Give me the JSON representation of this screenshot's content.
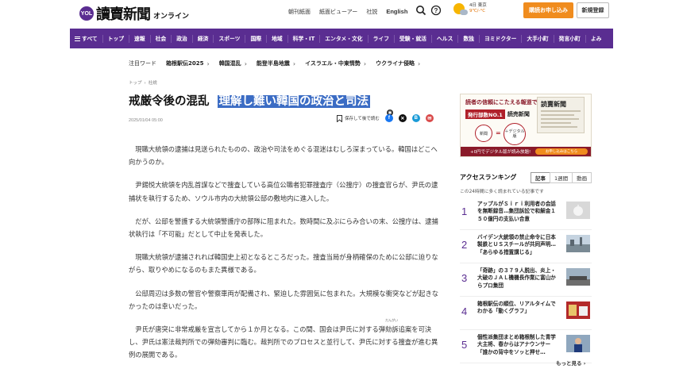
{
  "header": {
    "logo_badge": "YOL",
    "logo_text": "讀賣新聞",
    "logo_sub": "オンライン",
    "nav": [
      "朝刊紙面",
      "紙面ビューアー",
      "社説"
    ],
    "nav_english": "English",
    "weather": {
      "day": "4日 東京",
      "temp": "9℃/-°C"
    },
    "subscribe_label": "購読お申し込み",
    "register_label": "新規登録"
  },
  "mainnav": {
    "menu_label": "すべて",
    "items": [
      "トップ",
      "速報",
      "社会",
      "政治",
      "経済",
      "スポーツ",
      "国際",
      "地域",
      "科学・IT",
      "エンタメ・文化",
      "ライフ",
      "受験・就活",
      "ヘルス",
      "数独",
      "ヨミドクター",
      "大手小町",
      "発言小町",
      "よみ"
    ]
  },
  "focus": {
    "label": "注目ワード",
    "words": [
      "箱根駅伝2025",
      "韓国混乱",
      "能登半島地震",
      "イスラエル・中東情勢",
      "ウクライナ侵略"
    ]
  },
  "article": {
    "breadcrumb": [
      "トップ",
      "社説"
    ],
    "title_main": "戒厳令後の混乱",
    "title_highlight": "理解し難い韓国の政治と司法",
    "date": "2025/01/04 05:00",
    "save_label": "保存して後で読む",
    "paragraphs": [
      "現職大統領の逮捕は見送られたものの、政治や司法をめぐる混迷はむしろ深まっている。韓国はどこへ向かうのか。",
      "尹錫悦大統領を内乱首謀などで捜査している高位公職者犯罪捜査庁（公捜庁）の捜査官らが、尹氏の逮捕状を執行するため、ソウル市内の大統領公邸の敷地内に進入した。",
      "だが、公邸を警護する大統領警護庁の部隊に阻まれた。数時間に及ぶにらみ合いの末、公捜庁は、逮捕状執行は「不可能」だとして中止を発表した。",
      "現職大統領が逮捕されれば韓国史上初となるところだった。捜査当局が身柄確保のために公邸に迫りながら、取りやめになるのもまた異様である。",
      "公邸周辺は多数の警官や警察車両が配備され、緊迫した雰囲気に包まれた。大規模な衝突などが起きなかったのは幸いだった。"
    ],
    "last_paragraph": {
      "before": "尹氏が唐突に非常戒厳を宣言してから１か月となる。この間、国会は尹氏に対する",
      "ruby_base": "弾劾",
      "ruby_text": "だんがい",
      "after": "訴追案を可決し、尹氏は憲法裁判所での弾劾審判に臨む。裁判所でのプロセスと並行して、尹氏に対する捜査が進む異例の展開である。"
    }
  },
  "ad": {
    "headline": "読者の信頼にこたえる報道で",
    "badge": "発行部数NO.1",
    "badge_suffix": "読売新聞",
    "brand": "読賣新聞",
    "circle1": "新聞",
    "circle2": "＋デジタル版",
    "bar_text": "+0円でデジタル版が読み放題!",
    "bar_button": "お申し込みはこちら"
  },
  "ranking": {
    "title": "アクセスランキング",
    "tabs": [
      "記事",
      "1週間",
      "動画"
    ],
    "subtitle": "この24時間に多く読まれている記事です",
    "items": [
      {
        "rank": "1",
        "text": "アップルがＳｉｒｉ利用者の会話を無断録音…集団訴訟で和解金１５０億円の支払い合意"
      },
      {
        "rank": "2",
        "text": "バイデン大統領の禁止命令に日本製鉄とＵＳスチールが共同声明…「あらゆる措置講じる」"
      },
      {
        "rank": "3",
        "text": "「奇跡」の３７９人脱出、炎上・大破のＪＡＬ機機長作業に富山からプロ集団"
      },
      {
        "rank": "4",
        "text": "箱根駅伝の順位、リアルタイムでわかる「動くグラフ」"
      },
      {
        "rank": "5",
        "text": "個性派集団まとめ箱根制した青学大主将、春からはアナウンサー「誰かの背中をソッと押せ…"
      }
    ],
    "more_label": "もっと見る",
    "colors": {
      "accent": "#5a2d91"
    }
  }
}
